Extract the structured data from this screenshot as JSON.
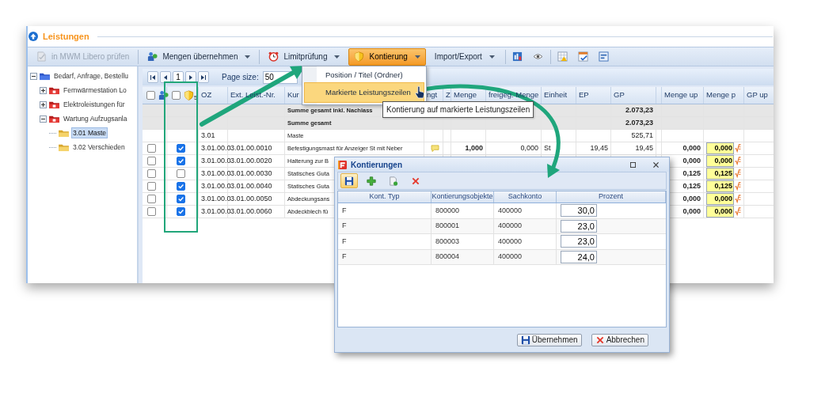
{
  "window": {
    "title": "Leistungen"
  },
  "toolbar": [
    {
      "kind": "check",
      "label": "in MWM Libero prüfen",
      "disabled": true,
      "active": false,
      "dropdown": false
    },
    {
      "kind": "transfer",
      "label": "Mengen übernehmen",
      "disabled": false,
      "active": false,
      "dropdown": true
    },
    {
      "kind": "limit",
      "label": "Limitprüfung",
      "disabled": false,
      "active": false,
      "dropdown": true
    },
    {
      "kind": "accounting",
      "label": "Kontierung",
      "disabled": false,
      "active": true,
      "dropdown": true
    },
    {
      "kind": "io",
      "label": "Import/Export",
      "disabled": false,
      "active": false,
      "dropdown": true
    }
  ],
  "tree": [
    {
      "kind": "root",
      "label": "Bedarf, Anfrage, Bestellu",
      "expanded": true,
      "selected": false,
      "children": [
        {
          "kind": "lot",
          "label": "Fernwärmestation Lo",
          "expanded": false,
          "selected": false
        },
        {
          "kind": "lot",
          "label": "Elektroleistungen für",
          "expanded": false,
          "selected": false
        },
        {
          "kind": "lot",
          "label": "Wartung Aufzugsanla",
          "expanded": true,
          "selected": false,
          "children": [
            {
              "kind": "folder",
              "label": "3.01 Maste",
              "selected": true
            },
            {
              "kind": "folder",
              "label": "3.02 Verschieden",
              "selected": false
            }
          ]
        }
      ]
    }
  ],
  "pager": {
    "page": "1",
    "page_size_label": "Page size:",
    "page_size": "50"
  },
  "grid": {
    "select_all_checked": false,
    "mark_all_checked": false,
    "mark_count": "5",
    "columns": [
      "OZ",
      "Ext. Leist.-Nr.",
      "Kur",
      "ngt",
      "Z",
      "Menge",
      "freigeg. Menge",
      "Einheit",
      "EP",
      "GP",
      "Menge up",
      "Menge p",
      "GP up"
    ],
    "rows": [
      {
        "kind": "summary",
        "text": "Summe gesamt inkl. Nachlass",
        "gp": "2.073,23"
      },
      {
        "kind": "summary",
        "text": "Summe gesamt",
        "gp": "2.073,23"
      },
      {
        "kind": "title",
        "oz": "3.01",
        "text": "Maste",
        "gp": "525,71"
      },
      {
        "kind": "item",
        "selected": false,
        "marked": true,
        "oz": "3.01.00.0",
        "ext": "3.01.00.0010",
        "text": "Befestigungsmast für Anzeiger St mit Neber",
        "note": true,
        "menge": "1,000",
        "freigeg": "0,000",
        "einheit": "St",
        "ep": "19,45",
        "gp": "19,45",
        "menge_up": "0,000",
        "menge_p": "0,000"
      },
      {
        "kind": "item",
        "selected": false,
        "marked": true,
        "oz": "3.01.00.0",
        "ext": "3.01.00.0020",
        "text": "Halterung zur B",
        "menge_up": "0,000",
        "menge_p": "0,000"
      },
      {
        "kind": "item",
        "selected": false,
        "marked": false,
        "oz": "3.01.00.0",
        "ext": "3.01.00.0030",
        "text": "Statisches Guta",
        "menge_up": "0,125",
        "menge_p": "0,125"
      },
      {
        "kind": "item",
        "selected": false,
        "marked": true,
        "oz": "3.01.00.0",
        "ext": "3.01.00.0040",
        "text": "Statisches Guta",
        "menge_up": "0,125",
        "menge_p": "0,125"
      },
      {
        "kind": "item",
        "selected": false,
        "marked": true,
        "oz": "3.01.00.0",
        "ext": "3.01.00.0050",
        "text": "Abdeckungsans",
        "menge_up": "0,000",
        "menge_p": "0,000"
      },
      {
        "kind": "item",
        "selected": false,
        "marked": true,
        "oz": "3.01.00.0",
        "ext": "3.01.00.0060",
        "text": "Abdeckblech fü",
        "menge_up": "0,000",
        "menge_p": "0,000"
      }
    ]
  },
  "menu": {
    "items": [
      {
        "label": "Position / Titel (Ordner)",
        "selected": false
      },
      {
        "label": "Markierte Leistungszeilen",
        "selected": true
      }
    ]
  },
  "tooltip": {
    "text": "Kontierung auf markierte Leistungszeilen"
  },
  "dialog": {
    "title": "Kontierungen",
    "tools": [
      {
        "kind": "save",
        "selected": true
      },
      {
        "kind": "add",
        "selected": false
      },
      {
        "kind": "new",
        "selected": false
      },
      {
        "kind": "delete",
        "selected": false
      }
    ],
    "columns": [
      "Kont. Typ",
      "Kontierungsobjekte",
      "Sachkonto",
      "Prozent"
    ],
    "rows": [
      {
        "typ": "F",
        "objekt": "800000",
        "sachkonto": "400000",
        "prozent": "30,0"
      },
      {
        "typ": "F",
        "objekt": "800001",
        "sachkonto": "400000",
        "prozent": "23,0"
      },
      {
        "typ": "F",
        "objekt": "800003",
        "sachkonto": "400000",
        "prozent": "23,0"
      },
      {
        "typ": "F",
        "objekt": "800004",
        "sachkonto": "400000",
        "prozent": "24,0"
      }
    ],
    "buttons": [
      {
        "kind": "save",
        "label": "Übernehmen"
      },
      {
        "kind": "cancel",
        "label": "Abbrechen"
      }
    ]
  }
}
